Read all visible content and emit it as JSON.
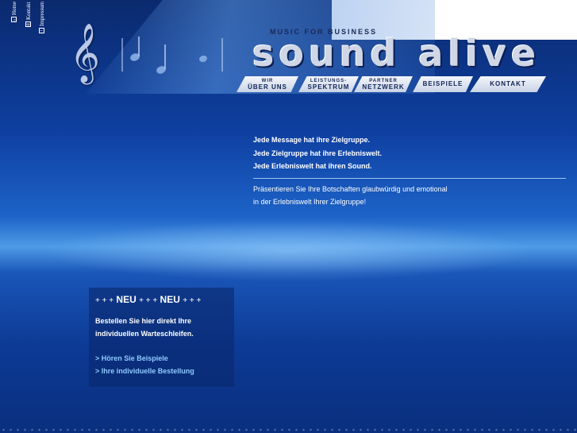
{
  "top_links": [
    {
      "label": "Home",
      "icon": "home-icon"
    },
    {
      "label": "Kontakt",
      "icon": "envelope-icon"
    },
    {
      "label": "Impressum",
      "icon": "info-icon"
    }
  ],
  "header": {
    "tagline": "Music for Business",
    "logo_text": "sound alive"
  },
  "nav": [
    {
      "top": "Wir",
      "bottom": "Über uns"
    },
    {
      "top": "Leistungs-",
      "bottom": "Spektrum"
    },
    {
      "top": "Partner",
      "bottom": "Netzwerk"
    },
    {
      "top": "",
      "bottom": "Beispiele"
    },
    {
      "top": "",
      "bottom": "Kontakt"
    }
  ],
  "intro": {
    "lines": [
      "Jede Message hat ihre Zielgruppe.",
      "Jede Zielgruppe hat ihre Erlebniswelt.",
      "Jede Erlebniswelt hat ihren Sound."
    ],
    "desc_line1": "Präsentieren Sie Ihre Botschaften glaubwürdig und emotional",
    "desc_line2": "in der Erlebniswelt Ihrer Zielgruppe!"
  },
  "news": {
    "plus": "+ + +",
    "neu": "NEU",
    "text_line1": "Bestellen Sie hier direkt Ihre",
    "text_line2": "individuellen Warteschleifen.",
    "link1": "> Hören Sie Beispiele",
    "link2": "> Ihre individuelle Bestellung"
  },
  "colors": {
    "background_top": "#0b2a6e",
    "background_glow": "#4f9be6",
    "link": "#8ec9ff"
  }
}
